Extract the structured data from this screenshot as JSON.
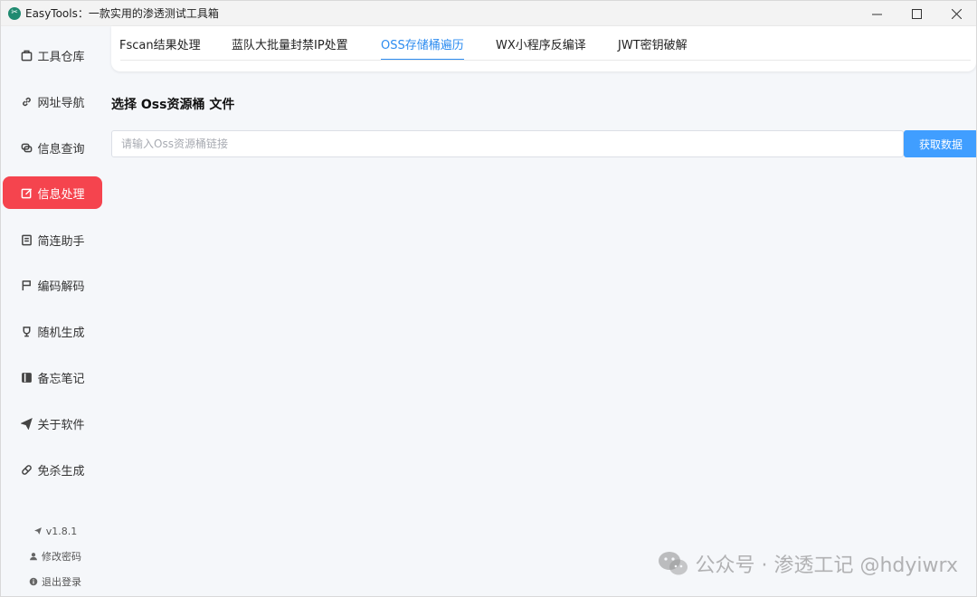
{
  "window": {
    "title": "EasyTools：一款实用的渗透测试工具箱",
    "minimize_symbol": "—",
    "close_symbol": "✕"
  },
  "sidebar": {
    "items": [
      {
        "label": "工具仓库",
        "icon": "box-icon"
      },
      {
        "label": "网址导航",
        "icon": "link-icon"
      },
      {
        "label": "信息查询",
        "icon": "chat-icon"
      },
      {
        "label": "信息处理",
        "icon": "edit-icon",
        "active": true
      },
      {
        "label": "简连助手",
        "icon": "document-icon"
      },
      {
        "label": "编码解码",
        "icon": "flag-icon"
      },
      {
        "label": "随机生成",
        "icon": "trophy-icon"
      },
      {
        "label": "备忘笔记",
        "icon": "notebook-icon"
      },
      {
        "label": "关于软件",
        "icon": "send-icon"
      },
      {
        "label": "免杀生成",
        "icon": "pill-icon"
      }
    ],
    "footer": {
      "version": "v1.8.1",
      "change_password": "修改密码",
      "logout": "退出登录"
    }
  },
  "tabs": [
    {
      "label": "Fscan结果处理"
    },
    {
      "label": "蓝队大批量封禁IP处置"
    },
    {
      "label": "OSS存储桶遍历",
      "active": true
    },
    {
      "label": "WX小程序反编译"
    },
    {
      "label": "JWT密钥破解"
    }
  ],
  "oss": {
    "section_title": "选择 Oss资源桶 文件",
    "input_placeholder": "请输入Oss资源桶链接",
    "input_value": "",
    "fetch_button": "获取数据"
  },
  "watermark": {
    "text": "公众号 · 渗透工记 @hdyiwrx"
  },
  "colors": {
    "active_nav": "#f5444e",
    "active_tab": "#2d8cf0",
    "primary_button": "#409eff"
  }
}
